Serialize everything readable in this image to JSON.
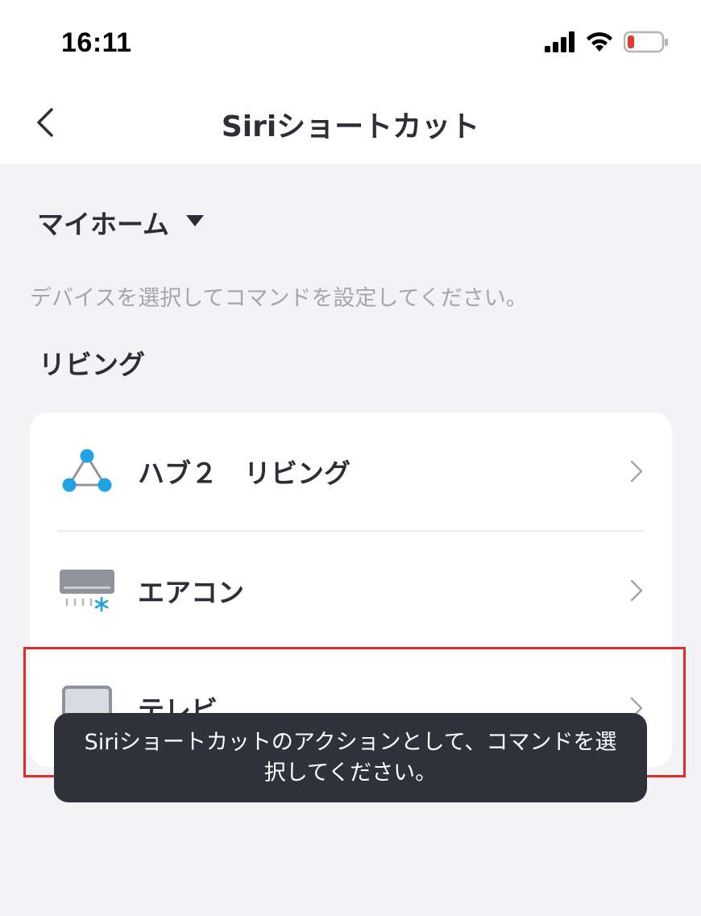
{
  "status_bar": {
    "time": "16:11",
    "icons": [
      "cellular-signal-icon",
      "wifi-icon",
      "battery-low-icon"
    ],
    "battery_color": "#e53935"
  },
  "nav": {
    "back_icon": "chevron-left-icon",
    "title": "Siriショートカット"
  },
  "home": {
    "name": "マイホーム",
    "dropdown_icon": "caret-down-icon"
  },
  "hint": "デバイスを選択してコマンドを設定してください。",
  "room": {
    "title": "リビング",
    "devices": [
      {
        "label": "ハブ２　リビング",
        "icon": "hub-icon",
        "accent": "#1fa3e6"
      },
      {
        "label": "エアコン",
        "icon": "air-conditioner-icon",
        "accent": "#1fa3e6"
      },
      {
        "label": "テレビ",
        "icon": "tv-icon",
        "accent": "#8e939c"
      }
    ]
  },
  "toast": {
    "message": "Siriショートカットのアクションとして、コマンドを選択してください。"
  },
  "colors": {
    "background": "#f3f3f6",
    "card": "#ffffff",
    "text_primary": "#2c2f37",
    "text_hint": "#a3a6ad",
    "toast_bg": "#2f323b",
    "highlight": "#e22b2b"
  }
}
